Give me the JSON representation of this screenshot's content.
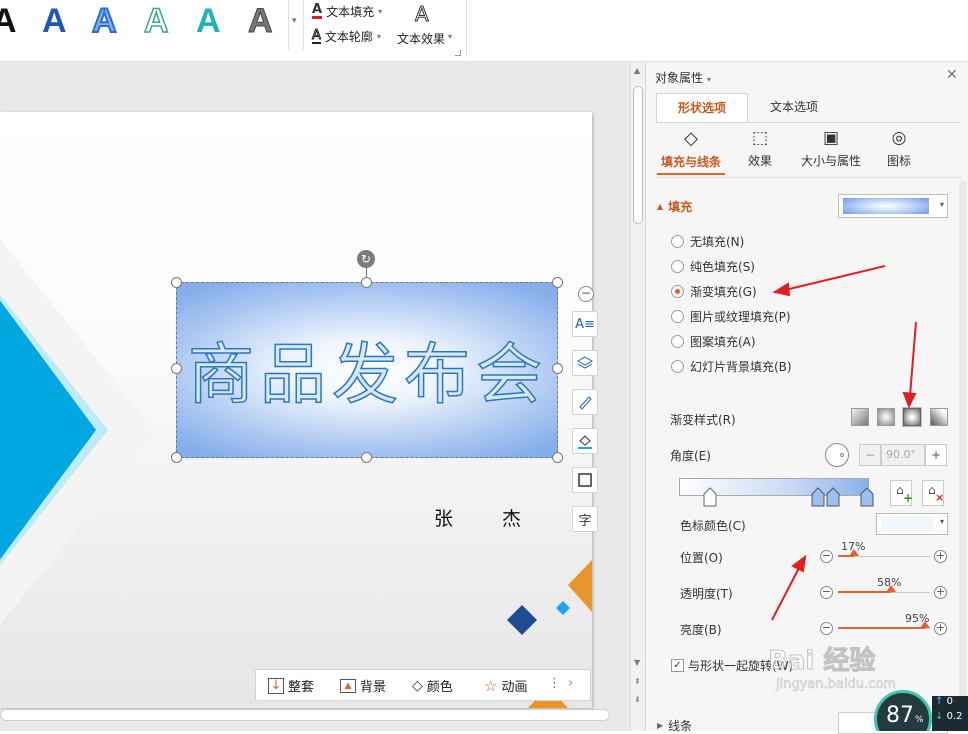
{
  "ribbon": {
    "text_fill": "文本填充",
    "text_outline": "文本轮廓",
    "text_effect": "文本效果",
    "art_letters": [
      "A",
      "A",
      "A",
      "A",
      "A",
      "A"
    ]
  },
  "slide": {
    "title": "商品发布会",
    "author_first": "张",
    "author_last": "杰"
  },
  "bottombar": {
    "items": [
      "整套",
      "背景",
      "颜色",
      "动画"
    ]
  },
  "panel": {
    "title": "对象属性",
    "tabs": [
      "形状选项",
      "文本选项"
    ],
    "subtabs": [
      "填充与线条",
      "效果",
      "大小与属性",
      "图标"
    ],
    "fill_header": "填充",
    "fill_options": [
      "无填充(N)",
      "纯色填充(S)",
      "渐变填充(G)",
      "图片或纹理填充(P)",
      "图案填充(A)",
      "幻灯片背景填充(B)"
    ],
    "selected_fill": "渐变填充(G)",
    "gradient_style_label": "渐变样式(R)",
    "angle_label": "角度(E)",
    "angle_value": "90.0°",
    "stop_color_label": "色标颜色(C)",
    "position_label": "位置(O)",
    "position_value": "17%",
    "transparency_label": "透明度(T)",
    "transparency_value": "58%",
    "brightness_label": "亮度(B)",
    "brightness_value": "95%",
    "rotate_with_shape": "与形状一起旋转(W)",
    "line_header": "线条"
  },
  "watermark": {
    "brand": "Bai 经验",
    "url": "jingyan.baidu.com"
  },
  "overlay": {
    "percent": "87",
    "pct_sign": "%",
    "stat1": "0",
    "stat2": "0.2"
  },
  "colors": {
    "accent": "#e0632a",
    "title_blue": "#2b78c2",
    "cyan": "#00a7e1",
    "orange": "#e8962a",
    "navy": "#1f4c93",
    "arrow": "#e02020"
  }
}
